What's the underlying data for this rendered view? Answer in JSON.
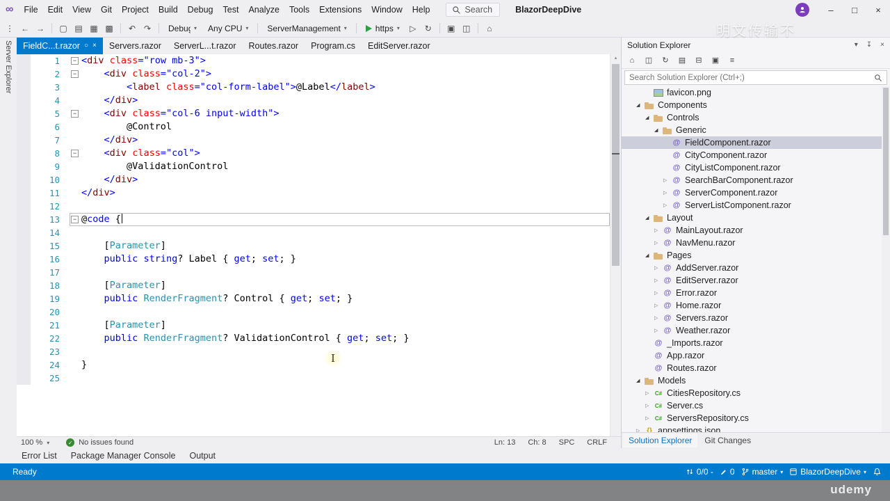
{
  "icons": {
    "logo": "∞",
    "minimize": "–",
    "maximize": "□",
    "close": "×",
    "pin": "○",
    "panel_pin": "↧",
    "chevron_down": "▾",
    "collapse_minus": "−",
    "tree_expanded": "◢",
    "tree_collapsed": "▷",
    "scroll_up": "▴",
    "scroll_down": "▾",
    "check": "✓",
    "cursor": "I"
  },
  "watermarks": {
    "top": "明文传输不",
    "bottom": "udemy"
  },
  "titlebar": {
    "menus": [
      "File",
      "Edit",
      "View",
      "Git",
      "Project",
      "Build",
      "Debug",
      "Test",
      "Analyze",
      "Tools",
      "Extensions",
      "Window",
      "Help"
    ],
    "search": "Search",
    "title": "BlazorDeepDive"
  },
  "toolbar": {
    "items": [
      {
        "type": "icon",
        "glyph": "⋮",
        "name": "toolbar-drag-handle"
      },
      {
        "type": "icon",
        "glyph": "←",
        "name": "navigate-backward-icon"
      },
      {
        "type": "icon",
        "glyph": "→",
        "name": "navigate-forward-icon"
      },
      {
        "type": "sep"
      },
      {
        "type": "icon",
        "glyph": "▢",
        "name": "new-file-icon"
      },
      {
        "type": "icon",
        "glyph": "▤",
        "name": "open-file-icon"
      },
      {
        "type": "icon",
        "glyph": "▦",
        "name": "save-icon"
      },
      {
        "type": "icon",
        "glyph": "▩",
        "name": "save-all-icon"
      },
      {
        "type": "sep"
      },
      {
        "type": "icon",
        "glyph": "↶",
        "name": "undo-icon"
      },
      {
        "type": "icon",
        "glyph": "↷",
        "name": "redo-icon"
      },
      {
        "type": "sep"
      },
      {
        "type": "dd",
        "text": "Debug",
        "name": "debug-configuration-dropdown"
      },
      {
        "type": "dd",
        "text": "Any CPU",
        "name": "platform-dropdown"
      },
      {
        "type": "sep"
      },
      {
        "type": "dd",
        "text": "ServerManagement",
        "name": "startup-project-dropdown"
      },
      {
        "type": "sep"
      },
      {
        "type": "run",
        "text": "https",
        "name": "run-button"
      },
      {
        "type": "icon",
        "glyph": "▷",
        "name": "start-without-debugging-icon"
      },
      {
        "type": "icon",
        "glyph": "↻",
        "name": "hot-reload-icon"
      },
      {
        "type": "sep"
      },
      {
        "type": "icon",
        "glyph": "▣",
        "name": "find-in-files-icon"
      },
      {
        "type": "icon",
        "glyph": "◫",
        "name": "command-window-icon"
      },
      {
        "type": "sep"
      },
      {
        "type": "icon",
        "glyph": "⌂",
        "name": "feedback-icon"
      }
    ]
  },
  "side_strip": {
    "label": "Server Explorer"
  },
  "editor": {
    "tabs": [
      {
        "label": "FieldC...t.razor",
        "active": true
      },
      {
        "label": "Servers.razor"
      },
      {
        "label": "ServerL...t.razor"
      },
      {
        "label": "Routes.razor"
      },
      {
        "label": "Program.cs"
      },
      {
        "label": "EditServer.razor"
      }
    ],
    "current_line": 13,
    "lines": [
      {
        "fold": true,
        "tokens": [
          [
            "<",
            "d"
          ],
          [
            "div",
            "t"
          ],
          [
            " ",
            "p"
          ],
          [
            "class",
            "a"
          ],
          [
            "=",
            "d"
          ],
          [
            "\"row mb-3\"",
            "s"
          ],
          [
            ">",
            "d"
          ]
        ]
      },
      {
        "fold": true,
        "tokens": [
          [
            "    ",
            "p"
          ],
          [
            "<",
            "d"
          ],
          [
            "div",
            "t"
          ],
          [
            " ",
            "p"
          ],
          [
            "class",
            "a"
          ],
          [
            "=",
            "d"
          ],
          [
            "\"col-2\"",
            "s"
          ],
          [
            ">",
            "d"
          ]
        ]
      },
      {
        "tokens": [
          [
            "        ",
            "p"
          ],
          [
            "<",
            "d"
          ],
          [
            "label",
            "t"
          ],
          [
            " ",
            "p"
          ],
          [
            "class",
            "a"
          ],
          [
            "=",
            "d"
          ],
          [
            "\"col-form-label\"",
            "s"
          ],
          [
            ">",
            "d"
          ],
          [
            "@Label",
            "p"
          ],
          [
            "</",
            "d"
          ],
          [
            "label",
            "t"
          ],
          [
            ">",
            "d"
          ]
        ]
      },
      {
        "tokens": [
          [
            "    ",
            "p"
          ],
          [
            "</",
            "d"
          ],
          [
            "div",
            "t"
          ],
          [
            ">",
            "d"
          ]
        ]
      },
      {
        "fold": true,
        "tokens": [
          [
            "    ",
            "p"
          ],
          [
            "<",
            "d"
          ],
          [
            "div",
            "t"
          ],
          [
            " ",
            "p"
          ],
          [
            "class",
            "a"
          ],
          [
            "=",
            "d"
          ],
          [
            "\"col-6 input-width\"",
            "s"
          ],
          [
            ">",
            "d"
          ]
        ]
      },
      {
        "tokens": [
          [
            "        @Control",
            "p"
          ]
        ]
      },
      {
        "tokens": [
          [
            "    ",
            "p"
          ],
          [
            "</",
            "d"
          ],
          [
            "div",
            "t"
          ],
          [
            ">",
            "d"
          ]
        ]
      },
      {
        "fold": true,
        "tokens": [
          [
            "    ",
            "p"
          ],
          [
            "<",
            "d"
          ],
          [
            "div",
            "t"
          ],
          [
            " ",
            "p"
          ],
          [
            "class",
            "a"
          ],
          [
            "=",
            "d"
          ],
          [
            "\"col\"",
            "s"
          ],
          [
            ">",
            "d"
          ]
        ]
      },
      {
        "tokens": [
          [
            "        @ValidationControl",
            "p"
          ]
        ]
      },
      {
        "tokens": [
          [
            "    ",
            "p"
          ],
          [
            "</",
            "d"
          ],
          [
            "div",
            "t"
          ],
          [
            ">",
            "d"
          ]
        ]
      },
      {
        "tokens": [
          [
            "</",
            "d"
          ],
          [
            "div",
            "t"
          ],
          [
            ">",
            "d"
          ]
        ]
      },
      {
        "tokens": []
      },
      {
        "fold": true,
        "tokens": [
          [
            "@",
            "p"
          ],
          [
            "code",
            "k"
          ],
          [
            " {",
            "p"
          ]
        ]
      },
      {
        "tokens": []
      },
      {
        "tokens": [
          [
            "    [",
            "p"
          ],
          [
            "Parameter",
            "y"
          ],
          [
            "]",
            "p"
          ]
        ]
      },
      {
        "tokens": [
          [
            "    ",
            "p"
          ],
          [
            "public",
            "k"
          ],
          [
            " ",
            "p"
          ],
          [
            "string",
            "k"
          ],
          [
            "? Label { ",
            "p"
          ],
          [
            "get",
            "k"
          ],
          [
            "; ",
            "p"
          ],
          [
            "set",
            "k"
          ],
          [
            "; }",
            "p"
          ]
        ]
      },
      {
        "tokens": []
      },
      {
        "tokens": [
          [
            "    [",
            "p"
          ],
          [
            "Parameter",
            "y"
          ],
          [
            "]",
            "p"
          ]
        ]
      },
      {
        "tokens": [
          [
            "    ",
            "p"
          ],
          [
            "public",
            "k"
          ],
          [
            " ",
            "p"
          ],
          [
            "RenderFragment",
            "y"
          ],
          [
            "? Control { ",
            "p"
          ],
          [
            "get",
            "k"
          ],
          [
            "; ",
            "p"
          ],
          [
            "set",
            "k"
          ],
          [
            "; }",
            "p"
          ]
        ]
      },
      {
        "tokens": []
      },
      {
        "tokens": [
          [
            "    [",
            "p"
          ],
          [
            "Parameter",
            "y"
          ],
          [
            "]",
            "p"
          ]
        ]
      },
      {
        "tokens": [
          [
            "    ",
            "p"
          ],
          [
            "public",
            "k"
          ],
          [
            " ",
            "p"
          ],
          [
            "RenderFragment",
            "y"
          ],
          [
            "? ValidationControl { ",
            "p"
          ],
          [
            "get",
            "k"
          ],
          [
            "; ",
            "p"
          ],
          [
            "set",
            "k"
          ],
          [
            "; }",
            "p"
          ]
        ]
      },
      {
        "tokens": []
      },
      {
        "tokens": [
          [
            "}",
            "p"
          ]
        ]
      },
      {
        "tokens": []
      }
    ],
    "status": {
      "zoom": "100 %",
      "issues": "No issues found",
      "ln": "Ln: 13",
      "ch": "Ch: 8",
      "spc": "SPC",
      "eol": "CRLF"
    }
  },
  "solution_explorer": {
    "title": "Solution Explorer",
    "search_placeholder": "Search Solution Explorer (Ctrl+;)",
    "toolbar_icons": [
      {
        "glyph": "⌂",
        "name": "switch-views-icon"
      },
      {
        "glyph": "◫",
        "name": "pending-changes-filter-icon"
      },
      {
        "glyph": "↻",
        "name": "refresh-icon"
      },
      {
        "glyph": "▤",
        "name": "show-all-files-icon"
      },
      {
        "glyph": "⊟",
        "name": "collapse-all-icon"
      },
      {
        "glyph": "▣",
        "name": "properties-icon"
      },
      {
        "glyph": "≡",
        "name": "preview-selected-items-icon"
      }
    ],
    "tree": [
      {
        "label": "favicon.png",
        "level": 2,
        "icon": "image",
        "chev": 0
      },
      {
        "label": "Components",
        "level": 1,
        "icon": "folder",
        "chev": 2
      },
      {
        "label": "Controls",
        "level": 2,
        "icon": "folder",
        "chev": 2
      },
      {
        "label": "Generic",
        "level": 3,
        "icon": "folder",
        "chev": 2
      },
      {
        "label": "FieldComponent.razor",
        "level": 4,
        "icon": "razor",
        "chev": 0,
        "selected": true
      },
      {
        "label": "CityComponent.razor",
        "level": 4,
        "icon": "razor",
        "chev": 0
      },
      {
        "label": "CityListComponent.razor",
        "level": 4,
        "icon": "razor",
        "chev": 0
      },
      {
        "label": "SearchBarComponent.razor",
        "level": 4,
        "icon": "razor",
        "chev": 1
      },
      {
        "label": "ServerComponent.razor",
        "level": 4,
        "icon": "razor",
        "chev": 1
      },
      {
        "label": "ServerListComponent.razor",
        "level": 4,
        "icon": "razor",
        "chev": 1
      },
      {
        "label": "Layout",
        "level": 2,
        "icon": "folder",
        "chev": 2
      },
      {
        "label": "MainLayout.razor",
        "level": 3,
        "icon": "razor",
        "chev": 1
      },
      {
        "label": "NavMenu.razor",
        "level": 3,
        "icon": "razor",
        "chev": 1
      },
      {
        "label": "Pages",
        "level": 2,
        "icon": "folder",
        "chev": 2
      },
      {
        "label": "AddServer.razor",
        "level": 3,
        "icon": "razor",
        "chev": 1
      },
      {
        "label": "EditServer.razor",
        "level": 3,
        "icon": "razor",
        "chev": 1
      },
      {
        "label": "Error.razor",
        "level": 3,
        "icon": "razor",
        "chev": 1
      },
      {
        "label": "Home.razor",
        "level": 3,
        "icon": "razor",
        "chev": 1
      },
      {
        "label": "Servers.razor",
        "level": 3,
        "icon": "razor",
        "chev": 1
      },
      {
        "label": "Weather.razor",
        "level": 3,
        "icon": "razor",
        "chev": 1
      },
      {
        "label": "_Imports.razor",
        "level": 2,
        "icon": "razor",
        "chev": 0
      },
      {
        "label": "App.razor",
        "level": 2,
        "icon": "razor",
        "chev": 0
      },
      {
        "label": "Routes.razor",
        "level": 2,
        "icon": "razor",
        "chev": 0
      },
      {
        "label": "Models",
        "level": 1,
        "icon": "folder",
        "chev": 2
      },
      {
        "label": "CitiesRepository.cs",
        "level": 2,
        "icon": "cs",
        "chev": 1
      },
      {
        "label": "Server.cs",
        "level": 2,
        "icon": "cs",
        "chev": 1
      },
      {
        "label": "ServersRepository.cs",
        "level": 2,
        "icon": "cs",
        "chev": 1
      },
      {
        "label": "appsettings.json",
        "level": 1,
        "icon": "json",
        "chev": 1
      }
    ],
    "bottom_tabs": [
      {
        "label": "Solution Explorer",
        "active": true
      },
      {
        "label": "Git Changes"
      }
    ]
  },
  "bottom_panels": [
    "Error List",
    "Package Manager Console",
    "Output"
  ],
  "statusbar": {
    "ready": "Ready",
    "sync_counts": "0/0 -",
    "pending_edits": "0",
    "branch": "master",
    "repo": "BlazorDeepDive"
  },
  "colors": {
    "accent": "#007ACC",
    "selection": "#CCCEDB",
    "keyword": "#0000FF",
    "type": "#2B91AF",
    "tag": "#800000",
    "attribute": "#FF0000"
  }
}
